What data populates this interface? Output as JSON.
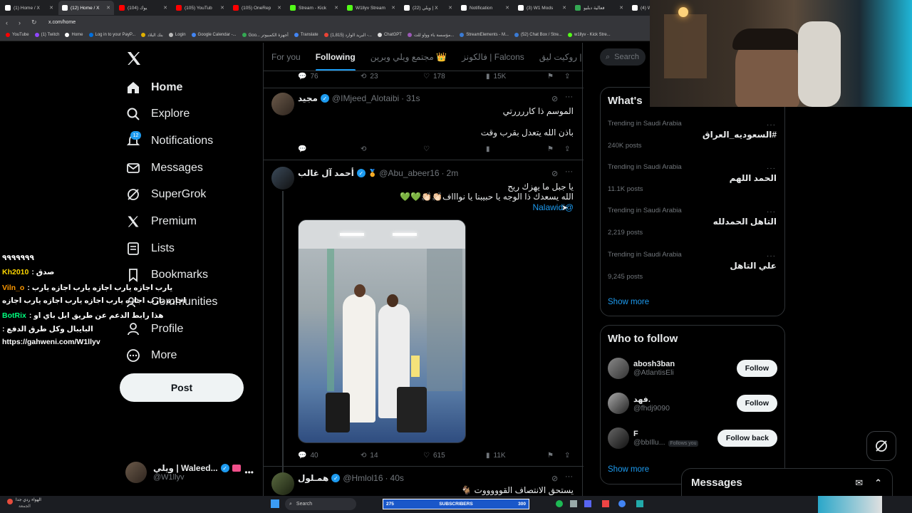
{
  "browser": {
    "tabs": [
      {
        "title": "(1) Home / X",
        "color": "#ffffff",
        "active": false
      },
      {
        "title": "(12) Home / X",
        "color": "#ffffff",
        "active": true
      },
      {
        "title": "(104) يوك",
        "color": "#ff0000",
        "active": false
      },
      {
        "title": "(105) YouTub",
        "color": "#ff0000",
        "active": false
      },
      {
        "title": "(105) OneRep",
        "color": "#ff0000",
        "active": false
      },
      {
        "title": "Stream - Kick",
        "color": "#53fc18",
        "active": false
      },
      {
        "title": "W1llyv Stream",
        "color": "#53fc18",
        "active": false
      },
      {
        "title": "(22) ويلي | X",
        "color": "#ffffff",
        "active": false
      },
      {
        "title": "Notification",
        "color": "#ffffff",
        "active": false
      },
      {
        "title": "(3) W1 Mods",
        "color": "#ffffff",
        "active": false
      },
      {
        "title": "فعالية دبليو",
        "color": "#34a853",
        "active": false
      },
      {
        "title": "(4) W1_raed",
        "color": "#ffffff",
        "active": false
      }
    ],
    "url": "x.com/home",
    "bookmarks": [
      {
        "label": "YouTube",
        "color": "#ff0000"
      },
      {
        "label": "(1) Twitch",
        "color": "#9146ff"
      },
      {
        "label": "Home",
        "color": "#ffffff"
      },
      {
        "label": "Log in to your PayP...",
        "color": "#0070e0"
      },
      {
        "label": "بنك البلاد",
        "color": "#e0b000"
      },
      {
        "label": "Login",
        "color": "#bbbbbb"
      },
      {
        "label": "Google Calendar -...",
        "color": "#4285f4"
      },
      {
        "label": "Goo... أجهزة الكمبيوتر",
        "color": "#34a853"
      },
      {
        "label": "Translate",
        "color": "#4285f4"
      },
      {
        "label": "البريد الوارد (1,815) -...",
        "color": "#ea4335"
      },
      {
        "label": "ChatGPT",
        "color": "#dddddd"
      },
      {
        "label": "مؤسسة باء وواو للت...",
        "color": "#9b59b6"
      },
      {
        "label": "StreamElements - M...",
        "color": "#3a7bd5"
      },
      {
        "label": "(52) Chat Box / Stre...",
        "color": "#3a7bd5"
      },
      {
        "label": "w1llyv - Kick Stre...",
        "color": "#53fc18"
      }
    ]
  },
  "nav": {
    "items": [
      {
        "label": "Home",
        "icon": "home-icon"
      },
      {
        "label": "Explore",
        "icon": "search-icon"
      },
      {
        "label": "Notifications",
        "icon": "bell-icon"
      },
      {
        "label": "Messages",
        "icon": "mail-icon"
      },
      {
        "label": "SuperGrok",
        "icon": "grok-icon"
      },
      {
        "label": "Premium",
        "icon": "x-icon"
      },
      {
        "label": "Lists",
        "icon": "list-icon"
      },
      {
        "label": "Bookmarks",
        "icon": "bookmark-icon"
      },
      {
        "label": "Communities",
        "icon": "communities-icon"
      },
      {
        "label": "Profile",
        "icon": "profile-icon"
      },
      {
        "label": "More",
        "icon": "more-icon"
      }
    ],
    "notification_count": "12",
    "post_label": "Post",
    "account_name": "ويلي | Waleed...",
    "account_handle": "@W1llyv"
  },
  "chat_overlay": {
    "lines": [
      {
        "user": "",
        "text": "٩٩٩٩٩٩٩"
      },
      {
        "user": "Kh2010",
        "text": ": صدق",
        "color": "#ffd700"
      },
      {
        "user": "Viln_o",
        "text": ": يارب اجازه يارب اجازه يارب اجازه يارب",
        "color": "#ff9900"
      },
      {
        "user": "",
        "text": "اجازه يارب اجازه يارب اجازه يارب اجازه يارب اجازه"
      },
      {
        "user": "BotRix",
        "text": ": هذا رابط الدعم عن طريق ابل باي او",
        "color": "#00ff7f"
      },
      {
        "user": "",
        "text": ": البايبال وكل طرق الدفع"
      },
      {
        "user": "",
        "text": "https://gahweni.com/W1llyv"
      }
    ]
  },
  "timeline": {
    "tabs": [
      "For you",
      "Following",
      "مجتمع ويلي وبرين 👑",
      "فالكونز | Falcons",
      "روكيت ليق | RL"
    ],
    "active_tab": "Following",
    "top_actions": {
      "replies": "76",
      "reposts": "23",
      "likes": "178",
      "views": "15K"
    },
    "tweets": [
      {
        "name": "مجيد",
        "handle": "@IMjeed_Alotaibi",
        "time": "31s",
        "lines": [
          "الموسم ذا كاررررتي",
          "باذن الله يتعدل بقرب وقت"
        ],
        "replies": "",
        "reposts": "",
        "likes": "",
        "views": ""
      },
      {
        "name": "أحمد آل غالب",
        "handle": "@Abu_abeer16",
        "time": "2m",
        "lines": [
          "يا جبل ما يهزك ريح",
          "الله يسعدك ذا الوجه يا حبيبنا يا نواااف👏🏻👏🏻💚💚"
        ],
        "mention": "@Nalawidi",
        "replies": "40",
        "reposts": "14",
        "likes": "615",
        "views": "11K"
      },
      {
        "name": "همـلول",
        "handle": "@Hmlol16",
        "time": "40s",
        "lines": [
          "يستحق الانتصاف القوووووت 🐐"
        ]
      }
    ]
  },
  "sidebar": {
    "search_placeholder": "Search",
    "trends_title": "What's",
    "trends": [
      {
        "meta": "Trending in Saudi Arabia",
        "name": "#السعوديه_العراق",
        "posts": "240K posts"
      },
      {
        "meta": "Trending in Saudi Arabia",
        "name": "الحمد اللهم",
        "posts": "11.1K posts"
      },
      {
        "meta": "Trending in Saudi Arabia",
        "name": "التاهل الحمدلله",
        "posts": "2,219 posts"
      },
      {
        "meta": "Trending in Saudi Arabia",
        "name": "علي التاهل",
        "posts": "9,245 posts"
      }
    ],
    "show_more": "Show more",
    "wtf_title": "Who to follow",
    "wtf": [
      {
        "name": "abosh3ban",
        "handle": "@AtlantisEli",
        "button": "Follow",
        "follows_you": ""
      },
      {
        "name": "فهد.",
        "handle": "@fhdj9090",
        "button": "Follow",
        "follows_you": ""
      },
      {
        "name": "F",
        "handle": "@bbIllu...",
        "button": "Follow back",
        "follows_you": "Follows you"
      }
    ],
    "wtf_show_more": "Show more",
    "messages_label": "Messages"
  },
  "taskbar": {
    "search_label": "Search",
    "weather_text": "الهواء ردي جدا",
    "weather_sub": "الجمعة",
    "subs_count": "275",
    "subs_label": "SUBSCRIBERS",
    "subs_goal": "300"
  },
  "colors": {
    "accent": "#1d9bf0",
    "bg": "#000000",
    "border": "#2f3336"
  }
}
